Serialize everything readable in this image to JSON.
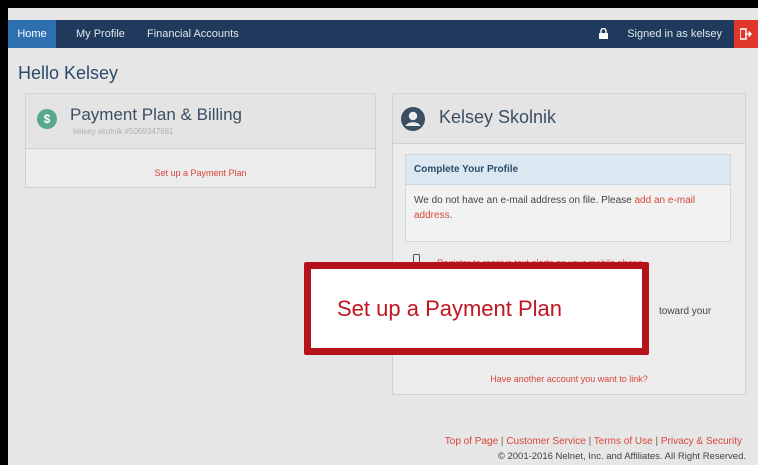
{
  "nav": {
    "home": "Home",
    "my_profile": "My Profile",
    "financial_accounts": "Financial Accounts",
    "signed_in": "Signed in as kelsey"
  },
  "greeting": "Hello Kelsey",
  "payment_panel": {
    "title": "Payment Plan & Billing",
    "subtitle": "kelsey skolnik #5069347681",
    "link": "Set up a Payment Plan"
  },
  "profile_panel": {
    "name": "Kelsey Skolnik",
    "complete_title": "Complete Your Profile",
    "message": "We do not have an e-mail address on file. Please ",
    "message_link": "add an e-mail address",
    "message_end": ".",
    "text_alerts": "Register to receive text alerts on your mobile phone.",
    "toward": "toward your",
    "other_account": "Have another account you want to link?"
  },
  "callout": {
    "text": "Set up a Payment Plan"
  },
  "footer": {
    "links": [
      "Top of Page",
      "Customer Service",
      "Terms of Use",
      "Privacy & Security"
    ],
    "separator": "|",
    "copyright": "© 2001-2016 Nelnet, Inc. and Affiliates. All Right Reserved."
  },
  "colors": {
    "nav_bg": "#1f3a5c",
    "nav_active": "#2e6fb0",
    "accent_red": "#d8463b",
    "callout_border": "#b5121b"
  },
  "icons": [
    "lock-icon",
    "logout-icon",
    "dollar-icon",
    "user-icon",
    "phone-icon"
  ]
}
